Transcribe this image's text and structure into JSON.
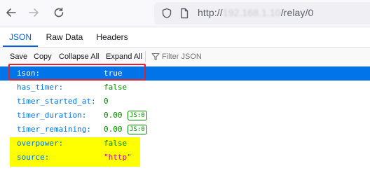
{
  "browser": {
    "back_icon": "arrow-left-icon",
    "forward_icon": "arrow-right-icon",
    "reload_icon": "reload-icon",
    "url": {
      "scheme": "http://",
      "host_redacted": "192.168.1.10",
      "path": "/relay/0"
    }
  },
  "tabs": [
    {
      "label": "JSON",
      "active": true
    },
    {
      "label": "Raw Data",
      "active": false
    },
    {
      "label": "Headers",
      "active": false
    }
  ],
  "toolbar": {
    "save": "Save",
    "copy": "Copy",
    "collapse_all": "Collapse All",
    "expand_all": "Expand All",
    "filter_placeholder": "Filter JSON"
  },
  "rows": [
    {
      "key": "ison:",
      "value": "true",
      "type": "bool",
      "selected": true
    },
    {
      "key": "has_timer:",
      "value": "false",
      "type": "bool"
    },
    {
      "key": "timer_started_at:",
      "value": "0",
      "type": "num"
    },
    {
      "key": "timer_duration:",
      "value": "0.00",
      "type": "num",
      "badge": "JS:0"
    },
    {
      "key": "timer_remaining:",
      "value": "0.00",
      "type": "num",
      "badge": "JS:0"
    },
    {
      "key": "overpower:",
      "value": "false",
      "type": "bool"
    },
    {
      "key": "source:",
      "value": "\"http\"",
      "type": "str"
    }
  ],
  "colors": {
    "accent": "#0060df",
    "selection": "#0074e8",
    "key": "#0074e8",
    "bool_num": "#058b00",
    "string": "#dd00a9",
    "annotation_red": "#e0202a",
    "annotation_yellow": "#ffff00"
  }
}
